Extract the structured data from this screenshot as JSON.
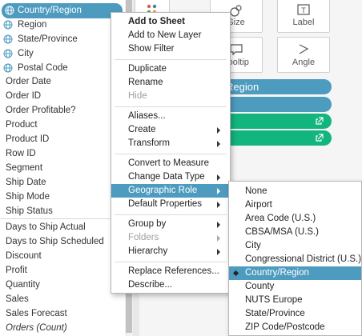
{
  "data_pane": {
    "geo_fields": [
      {
        "label": "Country/Region"
      },
      {
        "label": "Region"
      },
      {
        "label": "State/Province"
      },
      {
        "label": "City"
      },
      {
        "label": "Postal Code"
      }
    ],
    "dimension_fields": [
      "Order Date",
      "Order ID",
      "Order Profitable?",
      "Product",
      "Product ID",
      "Row ID",
      "Segment",
      "Ship Date",
      "Ship Mode",
      "Ship Status"
    ],
    "measure_fields": [
      "Days to Ship Actual",
      "Days to Ship Scheduled",
      "Discount",
      "Profit",
      "Quantity",
      "Sales",
      "Sales Forecast"
    ],
    "count_field": "Orders (Count)"
  },
  "marks_card": {
    "size_label": "Size",
    "label_label": "Label",
    "tooltip_label": "Tooltip",
    "angle_label": "Angle",
    "pill_region_text": "Region"
  },
  "context_menu": {
    "items": [
      "Add to Sheet",
      "Add to New Layer",
      "Show Filter",
      "Duplicate",
      "Rename",
      "Hide",
      "Aliases...",
      "Create",
      "Transform",
      "Convert to Measure",
      "Change Data Type",
      "Geographic Role",
      "Default Properties",
      "Group by",
      "Folders",
      "Hierarchy",
      "Replace References...",
      "Describe..."
    ]
  },
  "geo_submenu": {
    "items": [
      "None",
      "Airport",
      "Area Code (U.S.)",
      "CBSA/MSA (U.S.)",
      "City",
      "Congressional District (U.S.)",
      "Country/Region",
      "County",
      "NUTS Europe",
      "State/Province",
      "ZIP Code/Postcode"
    ],
    "selected": "Country/Region"
  },
  "colors": {
    "accent_blue": "#4d9bbf",
    "pill_green": "#12b57d"
  }
}
